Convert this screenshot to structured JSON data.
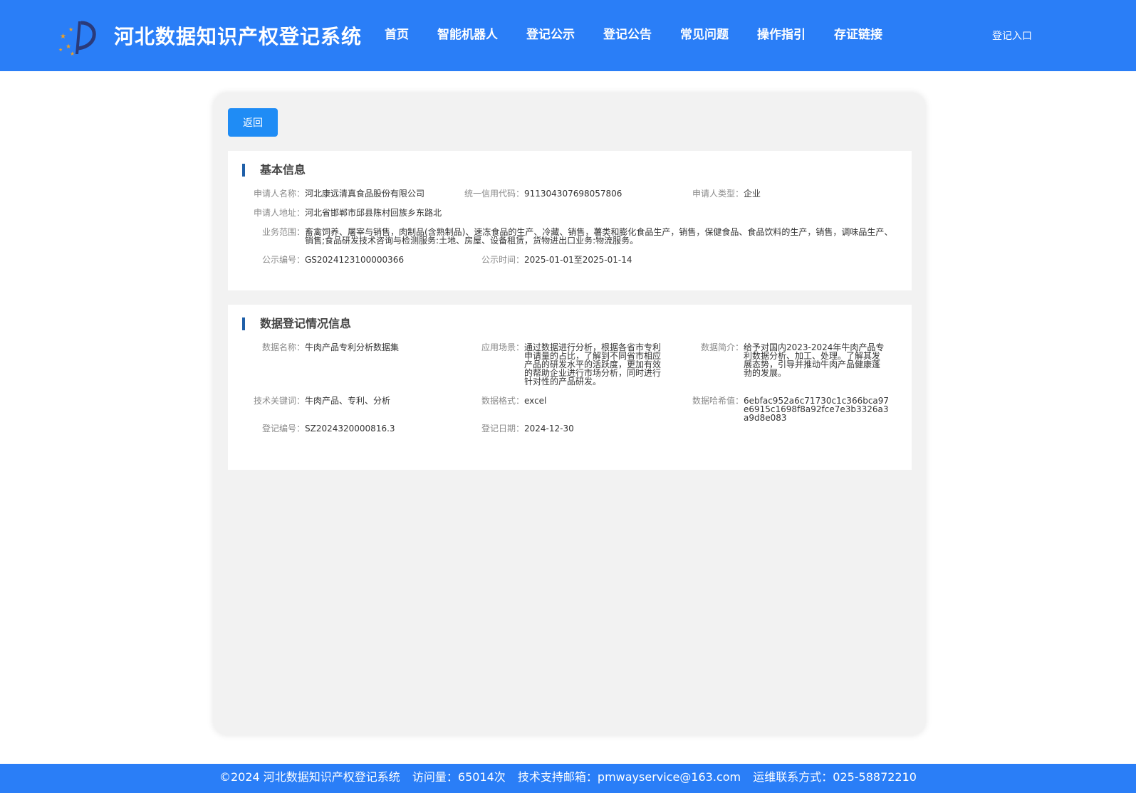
{
  "header": {
    "site_title": "河北数据知识产权登记系统",
    "nav": [
      "首页",
      "智能机器人",
      "登记公示",
      "登记公告",
      "常见问题",
      "操作指引",
      "存证链接"
    ],
    "login": "登记入口"
  },
  "back_button": "返回",
  "basic_info": {
    "title": "基本信息",
    "applicant_name_label": "申请人名称：",
    "applicant_name": "河北康远清真食品股份有限公司",
    "credit_code_label": "统一信用代码：",
    "credit_code": "911304307698057806",
    "applicant_type_label": "申请人类型：",
    "applicant_type": "企业",
    "address_label": "申请人地址：",
    "address": "河北省邯郸市邱县陈村回族乡东路北",
    "scope_label": "业务范围：",
    "scope": "畜禽饲养、屠宰与销售，肉制品(含熟制品)、速冻食品的生产、冷藏、销售，薯类和膨化食品生产，销售，保健食品、食品饮料的生产，销售，调味品生产、销售;食品研发技术咨询与检测服务:土地、房屋、设备租赁，货物进出口业务:物流服务。",
    "notice_no_label": "公示编号：",
    "notice_no": "GS2024123100000366",
    "notice_time_label": "公示时间：",
    "notice_time": "2025-01-01至2025-01-14"
  },
  "registration_info": {
    "title": "数据登记情况信息",
    "data_name_label": "数据名称：",
    "data_name": "牛肉产品专利分析数据集",
    "scenario_label": "应用场景：",
    "scenario": "通过数据进行分析，根据各省市专利申请量的占比，了解到不同省市相应产品的研发水平的活跃度，更加有效的帮助企业进行市场分析，同时进行针对性的产品研发。",
    "intro_label": "数据简介：",
    "intro": "给予对国内2023-2024年牛肉产品专利数据分析、加工、处理。了解其发展态势，引导并推动牛肉产品健康蓬勃的发展。",
    "keywords_label": "技术关键词：",
    "keywords": "牛肉产品、专利、分析",
    "format_label": "数据格式：",
    "format": "excel",
    "hash_label": "数据哈希值：",
    "hash": "6ebfac952a6c71730c1c366bca97e6915c1698f8a92fce7e3b3326a3a9d8e083",
    "reg_no_label": "登记编号：",
    "reg_no": "SZ2024320000816.3",
    "reg_date_label": "登记日期：",
    "reg_date": "2024-12-30"
  },
  "footer": {
    "copyright": "©2024 河北数据知识产权登记系统",
    "visits": "访问量：65014次",
    "email": "技术支持邮箱：pmwayservice@163.com",
    "contact": "运维联系方式：025-58872210"
  },
  "colors": {
    "brand_blue": "#2a7ef7",
    "button_blue": "#1f8cf5",
    "title_bar": "#1f5fa8"
  }
}
